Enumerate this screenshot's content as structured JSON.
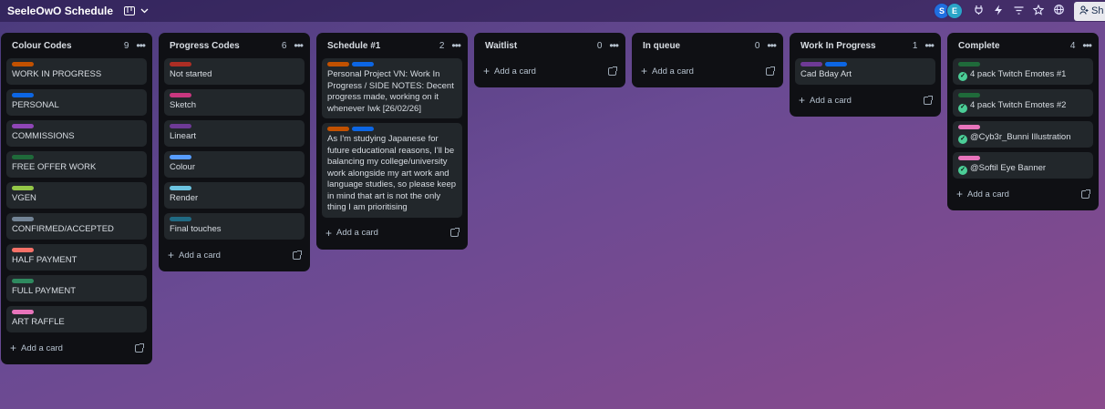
{
  "board": {
    "title": "SeeleOwO Schedule",
    "view_icon": "board-view-icon"
  },
  "topbar": {
    "avatars": [
      {
        "initial": "S",
        "color": "#1f6fe0"
      },
      {
        "initial": "E",
        "color": "#2aa5c8"
      }
    ],
    "icons": [
      "power-up-icon",
      "automation-icon",
      "filter-icon",
      "star-icon",
      "globe-icon"
    ],
    "share_label": "Sh"
  },
  "lists": [
    {
      "title": "Colour Codes",
      "count": "9",
      "cards": [
        {
          "labels": [
            "#c25100"
          ],
          "text": "WORK IN PROGRESS"
        },
        {
          "labels": [
            "#0c66e4"
          ],
          "text": "PERSONAL"
        },
        {
          "labels": [
            "#8f46b6"
          ],
          "text": "COMMISSIONS"
        },
        {
          "labels": [
            "#1f6a3a"
          ],
          "text": "FREE OFFER WORK"
        },
        {
          "labels": [
            "#94c748"
          ],
          "text": "VGEN"
        },
        {
          "labels": [
            "#738496"
          ],
          "text": "CONFIRMED/ACCEPTED"
        },
        {
          "labels": [
            "#f87168"
          ],
          "text": "HALF PAYMENT"
        },
        {
          "labels": [
            "#2e8a5f"
          ],
          "text": "FULL PAYMENT"
        },
        {
          "labels": [
            "#e774bb"
          ],
          "text": "ART RAFFLE"
        }
      ],
      "add_label": "Add a card"
    },
    {
      "title": "Progress Codes",
      "count": "6",
      "cards": [
        {
          "labels": [
            "#ae2e24"
          ],
          "text": "Not started"
        },
        {
          "labels": [
            "#c9377f"
          ],
          "text": "Sketch"
        },
        {
          "labels": [
            "#6e3a96"
          ],
          "text": "Lineart"
        },
        {
          "labels": [
            "#579dff"
          ],
          "text": "Colour"
        },
        {
          "labels": [
            "#6cc3e0"
          ],
          "text": "Render"
        },
        {
          "labels": [
            "#206a83"
          ],
          "text": "Final touches"
        }
      ],
      "add_label": "Add a card"
    },
    {
      "title": "Schedule #1",
      "count": "2",
      "cards": [
        {
          "labels": [
            "#c25100",
            "#0c66e4"
          ],
          "text": "Personal Project VN: Work In Progress / SIDE NOTES: Decent progress made, working on it whenever Iwk [26/02/26]"
        },
        {
          "labels": [
            "#c25100",
            "#0c66e4"
          ],
          "text": "As I'm studying Japanese for future educational reasons, I'll be balancing my college/university work alongside my art work and language studies, so please keep in mind that art is not the only thing I am prioritising"
        }
      ],
      "add_label": "Add a card"
    },
    {
      "title": "Waitlist",
      "count": "0",
      "cards": [],
      "add_label": "Add a card"
    },
    {
      "title": "In queue",
      "count": "0",
      "cards": [],
      "add_label": "Add a card"
    },
    {
      "title": "Work In Progress",
      "count": "1",
      "cards": [
        {
          "labels": [
            "#6e3a96",
            "#0c66e4"
          ],
          "text": "Cad Bday Art"
        }
      ],
      "add_label": "Add a card"
    },
    {
      "title": "Complete",
      "count": "4",
      "cards": [
        {
          "labels": [
            "#1f6a3a"
          ],
          "text": "4 pack Twitch Emotes #1",
          "done": true
        },
        {
          "labels": [
            "#1f6a3a"
          ],
          "text": "4 pack Twitch Emotes #2",
          "done": true
        },
        {
          "labels": [
            "#e774bb"
          ],
          "text": "@Cyb3r_Bunni Illustration",
          "done": true
        },
        {
          "labels": [
            "#e774bb"
          ],
          "text": "@Softil Eye Banner",
          "done": true
        }
      ],
      "add_label": "Add a card"
    }
  ]
}
